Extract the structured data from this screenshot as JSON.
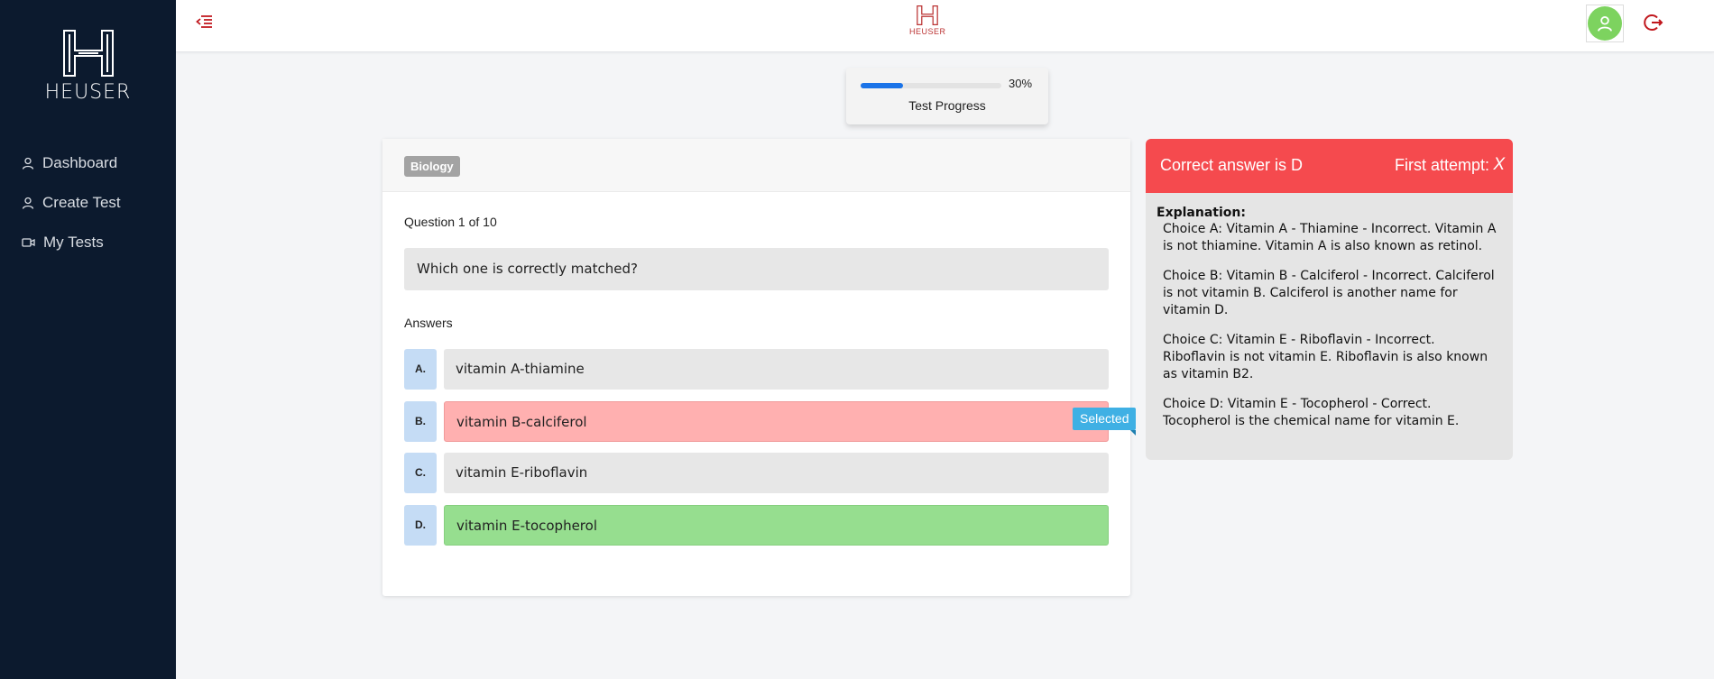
{
  "brand": {
    "name": "HEUSER"
  },
  "sidebar": {
    "items": [
      {
        "label": "Dashboard",
        "icon": "user-icon"
      },
      {
        "label": "Create Test",
        "icon": "user-icon"
      },
      {
        "label": "My Tests",
        "icon": "video-icon"
      }
    ]
  },
  "topbar": {
    "menu_icon": "menu-collapse-icon",
    "logo_text": "HEUSER",
    "logout_icon": "logout-icon"
  },
  "progress": {
    "percent_label": "30%",
    "percent": 30,
    "label": "Test Progress"
  },
  "question": {
    "subject": "Biology",
    "count": "Question 1 of 10",
    "text": "Which one is correctly matched?",
    "answers_label": "Answers",
    "answers": [
      {
        "letter": "A.",
        "text": "vitamin A-thiamine",
        "state": "neutral"
      },
      {
        "letter": "B.",
        "text": "vitamin B-calciferol",
        "state": "wrong",
        "tag": "Selected"
      },
      {
        "letter": "C.",
        "text": "vitamin E-riboflavin",
        "state": "neutral"
      },
      {
        "letter": "D.",
        "text": "vitamin E-tocopherol",
        "state": "correct"
      }
    ]
  },
  "result": {
    "correct_text": "Correct answer is D",
    "attempt_label": "First attempt:",
    "attempt_mark": "X",
    "explanation_title": "Explanation:",
    "choices": [
      "Choice A: Vitamin A - Thiamine - Incorrect. Vitamin A is not thiamine. Vitamin A is also known as retinol.",
      "Choice B: Vitamin B - Calciferol - Incorrect. Calciferol is not vitamin B. Calciferol is another name for vitamin D.",
      "Choice C: Vitamin E - Riboflavin - Incorrect. Riboflavin is not vitamin E. Riboflavin is also known as vitamin B2.",
      "Choice D: Vitamin E - Tocopherol - Correct. Tocopherol is the chemical name for vitamin E."
    ]
  },
  "colors": {
    "sidebar_bg": "#0c1a2e",
    "accent_red": "#f54a4e",
    "wrong_answer": "#ffb0b0",
    "correct_answer": "#96de8f",
    "progress_fill": "#1a73e8",
    "selected_tag": "#3fb0e4"
  }
}
